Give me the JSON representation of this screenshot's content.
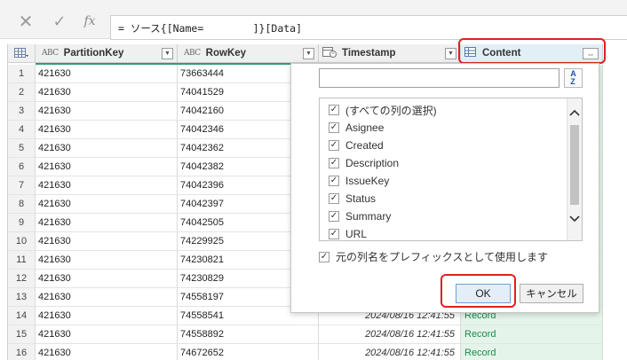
{
  "formula_bar": {
    "cancel_icon": "close-icon",
    "commit_icon": "check-icon",
    "fx_label": "fx",
    "formula": "= ソース{[Name=        ]}[Data]"
  },
  "grid": {
    "columns": [
      {
        "name": "PartitionKey",
        "type_icon": "ABC"
      },
      {
        "name": "RowKey",
        "type_icon": "ABC"
      },
      {
        "name": "Timestamp",
        "type_icon": "datetime-icon"
      },
      {
        "name": "Content",
        "type_icon": "table-icon"
      }
    ],
    "rows": [
      {
        "n": "1",
        "pk": "421630",
        "rk": "73663444",
        "ts": "",
        "ct": ""
      },
      {
        "n": "2",
        "pk": "421630",
        "rk": "74041529",
        "ts": "",
        "ct": ""
      },
      {
        "n": "3",
        "pk": "421630",
        "rk": "74042160",
        "ts": "",
        "ct": ""
      },
      {
        "n": "4",
        "pk": "421630",
        "rk": "74042346",
        "ts": "",
        "ct": ""
      },
      {
        "n": "5",
        "pk": "421630",
        "rk": "74042362",
        "ts": "",
        "ct": ""
      },
      {
        "n": "6",
        "pk": "421630",
        "rk": "74042382",
        "ts": "",
        "ct": ""
      },
      {
        "n": "7",
        "pk": "421630",
        "rk": "74042396",
        "ts": "",
        "ct": ""
      },
      {
        "n": "8",
        "pk": "421630",
        "rk": "74042397",
        "ts": "",
        "ct": ""
      },
      {
        "n": "9",
        "pk": "421630",
        "rk": "74042505",
        "ts": "",
        "ct": ""
      },
      {
        "n": "10",
        "pk": "421630",
        "rk": "74229925",
        "ts": "",
        "ct": ""
      },
      {
        "n": "11",
        "pk": "421630",
        "rk": "74230821",
        "ts": "",
        "ct": ""
      },
      {
        "n": "12",
        "pk": "421630",
        "rk": "74230829",
        "ts": "",
        "ct": ""
      },
      {
        "n": "13",
        "pk": "421630",
        "rk": "74558197",
        "ts": "",
        "ct": ""
      },
      {
        "n": "14",
        "pk": "421630",
        "rk": "74558541",
        "ts": "2024/08/16 12:41:55",
        "ct": "Record"
      },
      {
        "n": "15",
        "pk": "421630",
        "rk": "74558892",
        "ts": "2024/08/16 12:41:55",
        "ct": "Record"
      },
      {
        "n": "16",
        "pk": "421630",
        "rk": "74672652",
        "ts": "2024/08/16 12:41:55",
        "ct": "Record"
      }
    ]
  },
  "expand_popup": {
    "search_value": "",
    "sort_icon": "sort-az-icon",
    "items": [
      {
        "label": "(すべての列の選択)",
        "checked": true
      },
      {
        "label": "Asignee",
        "checked": true
      },
      {
        "label": "Created",
        "checked": true
      },
      {
        "label": "Description",
        "checked": true
      },
      {
        "label": "IssueKey",
        "checked": true
      },
      {
        "label": "Status",
        "checked": true
      },
      {
        "label": "Summary",
        "checked": true
      },
      {
        "label": "URL",
        "checked": true
      }
    ],
    "prefix_label": "元の列名をプレフィックスとして使用します",
    "prefix_checked": true,
    "ok_label": "OK",
    "cancel_label": "キャンセル"
  },
  "colors": {
    "highlight": "#e02020",
    "record_text": "#1e8a4a",
    "record_bg": "#e4f4ea"
  }
}
